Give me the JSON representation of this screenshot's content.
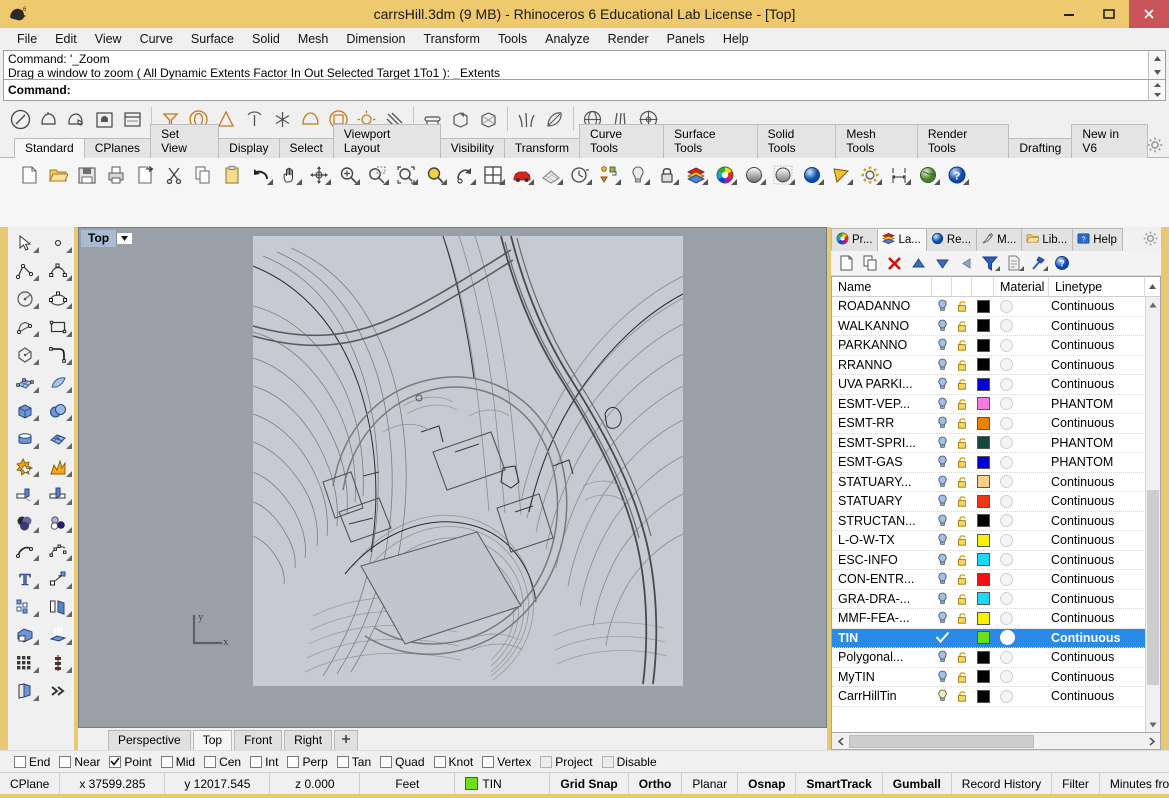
{
  "window": {
    "title": "carrsHill.3dm (9 MB) - Rhinoceros 6 Educational Lab License - [Top]",
    "app_icon": "rhino-logo-icon",
    "minimize": "minimize-icon",
    "maximize": "maximize-icon",
    "close": "close-icon",
    "titlebar_color": "#eec96e",
    "close_color": "#c9555a"
  },
  "menu": {
    "items": [
      "File",
      "Edit",
      "View",
      "Curve",
      "Surface",
      "Solid",
      "Mesh",
      "Dimension",
      "Transform",
      "Tools",
      "Analyze",
      "Render",
      "Panels",
      "Help"
    ]
  },
  "command": {
    "history_line1": "Command: '_Zoom",
    "history_line2": "Drag a window to zoom ( All  Dynamic  Extents  Factor  In  Out  Selected  Target  1To1 ): _Extents",
    "prompt": "Command:"
  },
  "plugin_toolbar": {
    "icons": [
      "stroke-circle-icon",
      "teapot-icon",
      "teapot-hand-icon",
      "cup-box-icon",
      "window-icon",
      "sep",
      "funnel-icon",
      "ellipse-solid-icon",
      "cone-icon",
      "tree-icon",
      "asterisk-icon",
      "dome-icon",
      "cube-sphere-icon",
      "sun-icon",
      "rays-icon",
      "sep",
      "bench-icon",
      "box-star-icon",
      "box-faceted-icon",
      "sep",
      "grass-icon",
      "leaf-icon",
      "sep",
      "globe-hand-icon",
      "wall-icon",
      "target-circle-icon"
    ]
  },
  "tabs": {
    "items": [
      "Standard",
      "CPlanes",
      "Set View",
      "Display",
      "Select",
      "Viewport Layout",
      "Visibility",
      "Transform",
      "Curve Tools",
      "Surface Tools",
      "Solid Tools",
      "Mesh Tools",
      "Render Tools",
      "Drafting",
      "New in V6"
    ],
    "active": "Standard",
    "gear": "gear-icon"
  },
  "standard_toolbar": {
    "icons": [
      "new-file-icon",
      "open-folder-icon",
      "save-icon",
      "print-icon",
      "export-icon",
      "cut-scissors-icon",
      "copy-icon",
      "paste-icon",
      "undo-icon",
      "pan-hand-icon",
      "move-gumball-icon",
      "zoom-in-icon",
      "zoom-window-dotted-icon",
      "zoom-extents-icon",
      "zoom-selected-icon",
      "rotate-view-icon",
      "viewport-layout-icon",
      "car-render-icon",
      "grid-icon",
      "clock-icon",
      "point-triangle-icon",
      "light-bulb-icon",
      "lock-icon",
      "layers-color-icon",
      "color-wheel-icon",
      "shaded-sphere-icon",
      "ghosted-sphere-icon",
      "rendered-sphere-icon",
      "flat-shade-icon",
      "gear-settings-icon",
      "dimension-icon",
      "earth-render-icon",
      "help-icon"
    ]
  },
  "left_toolbar": {
    "icons": [
      "select-arrow-icon",
      "point-icon",
      "polyline-icon",
      "curve-icon",
      "circle-icon",
      "ellipse-icon",
      "arc-icon",
      "rectangle-icon",
      "polygon-icon",
      "curve-fillet-icon",
      "surface-grid-icon",
      "surface-sweep-icon",
      "box-icon",
      "sphere-union-icon",
      "cylinder-icon",
      "mesh-box-icon",
      "boolean-star-icon",
      "explode-icon",
      "trim-icon",
      "split-icon",
      "boolean-union-icon",
      "boolean-circles-icon",
      "curve-edit-icon",
      "curve-point-edit-icon",
      "text-icon",
      "dimension-arrow-icon",
      "array-icon",
      "mirror-icon",
      "extrude-solid-icon",
      "extrude-arrows-icon",
      "array-grid-icon",
      "array-polar-icon",
      "unroll-icon",
      "more-chevron-icon"
    ]
  },
  "viewport": {
    "label": "Top",
    "dropdown_icon": "chevron-down-icon",
    "axis_x": "x",
    "axis_y": "y",
    "background_color": "#9aa0a8",
    "drawing_color": "#c6cbd3",
    "tabs": [
      "Perspective",
      "Top",
      "Front",
      "Right"
    ],
    "active_tab": "Top",
    "add_tab": "plus-icon"
  },
  "panel": {
    "tabs": [
      {
        "label": "Pr...",
        "icon": "color-wheel-icon"
      },
      {
        "label": "La...",
        "icon": "layers-icon"
      },
      {
        "label": "Re...",
        "icon": "render-sphere-icon"
      },
      {
        "label": "M...",
        "icon": "material-brush-icon"
      },
      {
        "label": "Lib...",
        "icon": "library-folder-icon"
      },
      {
        "label": "Help",
        "icon": "help-panel-icon"
      }
    ],
    "active_tab": "La...",
    "gear": "gear-icon",
    "toolbar_icons": [
      "new-layer-icon",
      "duplicate-layer-icon",
      "delete-layer-icon",
      "move-up-icon",
      "move-down-icon",
      "move-left-icon",
      "filter-icon",
      "properties-icon",
      "tools-hammer-icon",
      "help-icon"
    ],
    "columns": [
      "Name",
      "",
      "",
      "",
      "Material",
      "Linetype"
    ],
    "sort_icon": "chevron-up-icon",
    "layers": [
      {
        "name": "ROADANNO",
        "visible": true,
        "locked": false,
        "color": "#000000",
        "linetype": "Continuous",
        "selected": false
      },
      {
        "name": "WALKANNO",
        "visible": true,
        "locked": false,
        "color": "#000000",
        "linetype": "Continuous",
        "selected": false
      },
      {
        "name": "PARKANNO",
        "visible": true,
        "locked": false,
        "color": "#000000",
        "linetype": "Continuous",
        "selected": false
      },
      {
        "name": "RRANNO",
        "visible": true,
        "locked": false,
        "color": "#000000",
        "linetype": "Continuous",
        "selected": false
      },
      {
        "name": "UVA PARKI...",
        "visible": true,
        "locked": false,
        "color": "#0000d8",
        "linetype": "Continuous",
        "selected": false
      },
      {
        "name": "ESMT-VEP...",
        "visible": true,
        "locked": false,
        "color": "#f77ae0",
        "linetype": "PHANTOM",
        "selected": false
      },
      {
        "name": "ESMT-RR",
        "visible": true,
        "locked": false,
        "color": "#f08000",
        "linetype": "Continuous",
        "selected": false
      },
      {
        "name": "ESMT-SPRI...",
        "visible": true,
        "locked": false,
        "color": "#14473f",
        "linetype": "PHANTOM",
        "selected": false
      },
      {
        "name": "ESMT-GAS",
        "visible": true,
        "locked": false,
        "color": "#0000d8",
        "linetype": "PHANTOM",
        "selected": false
      },
      {
        "name": "STATUARY...",
        "visible": true,
        "locked": false,
        "color": "#f7ce8c",
        "linetype": "Continuous",
        "selected": false
      },
      {
        "name": "STATUARY",
        "visible": true,
        "locked": false,
        "color": "#f03616",
        "linetype": "Continuous",
        "selected": false
      },
      {
        "name": "STRUCTAN...",
        "visible": true,
        "locked": false,
        "color": "#000000",
        "linetype": "Continuous",
        "selected": false
      },
      {
        "name": "L-O-W-TX",
        "visible": true,
        "locked": false,
        "color": "#f8f000",
        "linetype": "Continuous",
        "selected": false
      },
      {
        "name": "ESC-INFO",
        "visible": true,
        "locked": false,
        "color": "#1ed8f8",
        "linetype": "Continuous",
        "selected": false
      },
      {
        "name": "CON-ENTR...",
        "visible": true,
        "locked": false,
        "color": "#f01010",
        "linetype": "Continuous",
        "selected": false
      },
      {
        "name": "GRA-DRA-...",
        "visible": true,
        "locked": false,
        "color": "#1ed8f8",
        "linetype": "Continuous",
        "selected": false
      },
      {
        "name": "MMF-FEA-...",
        "visible": true,
        "locked": false,
        "color": "#f8f000",
        "linetype": "Continuous",
        "selected": false
      },
      {
        "name": "TIN",
        "visible": true,
        "locked": false,
        "color": "#6ae018",
        "linetype": "Continuous",
        "selected": true
      },
      {
        "name": "Polygonal...",
        "visible": true,
        "locked": false,
        "color": "#000000",
        "linetype": "Continuous",
        "selected": false
      },
      {
        "name": "MyTIN",
        "visible": true,
        "locked": false,
        "color": "#000000",
        "linetype": "Continuous",
        "selected": false
      },
      {
        "name": "CarrHillTin",
        "visible": true,
        "locked": false,
        "color": "#000000",
        "linetype": "Continuous",
        "selected": false
      }
    ]
  },
  "osnap": {
    "items": [
      {
        "label": "End",
        "checked": false,
        "disabled": false
      },
      {
        "label": "Near",
        "checked": false,
        "disabled": false
      },
      {
        "label": "Point",
        "checked": true,
        "disabled": false
      },
      {
        "label": "Mid",
        "checked": false,
        "disabled": false
      },
      {
        "label": "Cen",
        "checked": false,
        "disabled": false
      },
      {
        "label": "Int",
        "checked": false,
        "disabled": false
      },
      {
        "label": "Perp",
        "checked": false,
        "disabled": false
      },
      {
        "label": "Tan",
        "checked": false,
        "disabled": false
      },
      {
        "label": "Quad",
        "checked": false,
        "disabled": false
      },
      {
        "label": "Knot",
        "checked": false,
        "disabled": false
      },
      {
        "label": "Vertex",
        "checked": false,
        "disabled": false
      },
      {
        "label": "Project",
        "checked": false,
        "disabled": true
      },
      {
        "label": "Disable",
        "checked": false,
        "disabled": true
      }
    ]
  },
  "statusbar": {
    "cplane": "CPlane",
    "x": "x 37599.285",
    "y": "y 12017.545",
    "z": "z 0.000",
    "units": "Feet",
    "layer": "TIN",
    "layer_color": "#6ae018",
    "toggles": [
      {
        "label": "Grid Snap",
        "bold": true
      },
      {
        "label": "Ortho",
        "bold": true
      },
      {
        "label": "Planar",
        "bold": false
      },
      {
        "label": "Osnap",
        "bold": true
      },
      {
        "label": "SmartTrack",
        "bold": true
      },
      {
        "label": "Gumball",
        "bold": true
      },
      {
        "label": "Record History",
        "bold": false
      },
      {
        "label": "Filter",
        "bold": false
      },
      {
        "label": "Minutes from ...",
        "bold": false
      }
    ]
  }
}
